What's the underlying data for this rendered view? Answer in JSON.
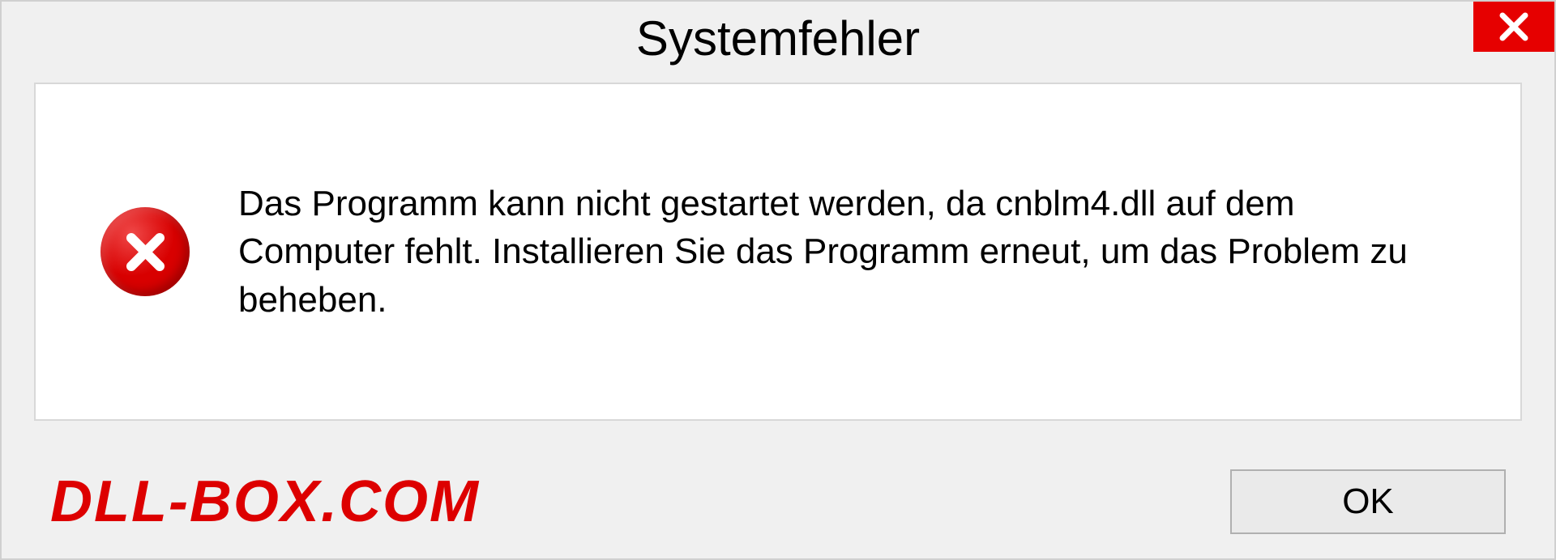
{
  "dialog": {
    "title": "Systemfehler",
    "message": "Das Programm kann nicht gestartet werden, da cnblm4.dll auf dem Computer fehlt. Installieren Sie das Programm erneut, um das Problem zu beheben.",
    "ok_label": "OK"
  },
  "watermark": "DLL-BOX.COM"
}
